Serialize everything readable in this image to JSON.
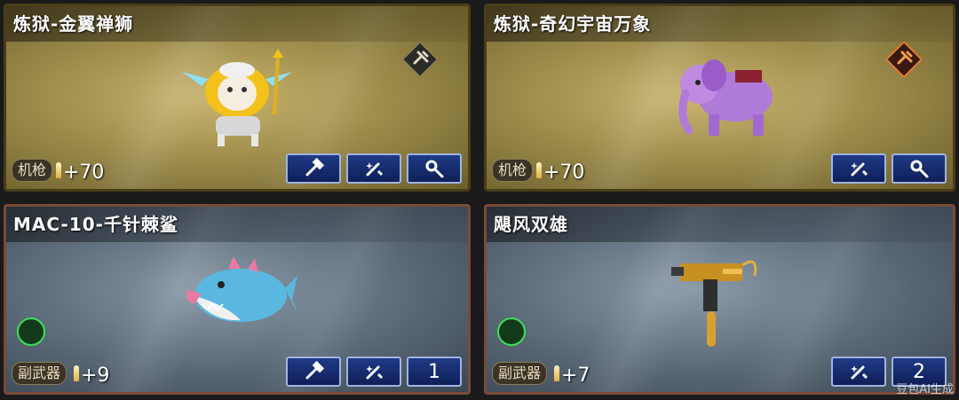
{
  "cards": [
    {
      "title": "炼狱-金翼禅狮",
      "category": "机枪",
      "bonus": "+70"
    },
    {
      "title": "炼狱-奇幻宇宙万象",
      "category": "机枪",
      "bonus": "+70"
    },
    {
      "title": "MAC-10-千针棘鲨",
      "category": "副武器",
      "bonus": "+9",
      "count": "1"
    },
    {
      "title": "飓风双雄",
      "category": "副武器",
      "bonus": "+7",
      "count": "2"
    }
  ],
  "watermark": "豆包AI生成",
  "colors": {
    "gold_card": "#a08f4d",
    "steel_card": "#5f6e7c",
    "button": "#1f3a86",
    "chip": "#3be05a"
  }
}
